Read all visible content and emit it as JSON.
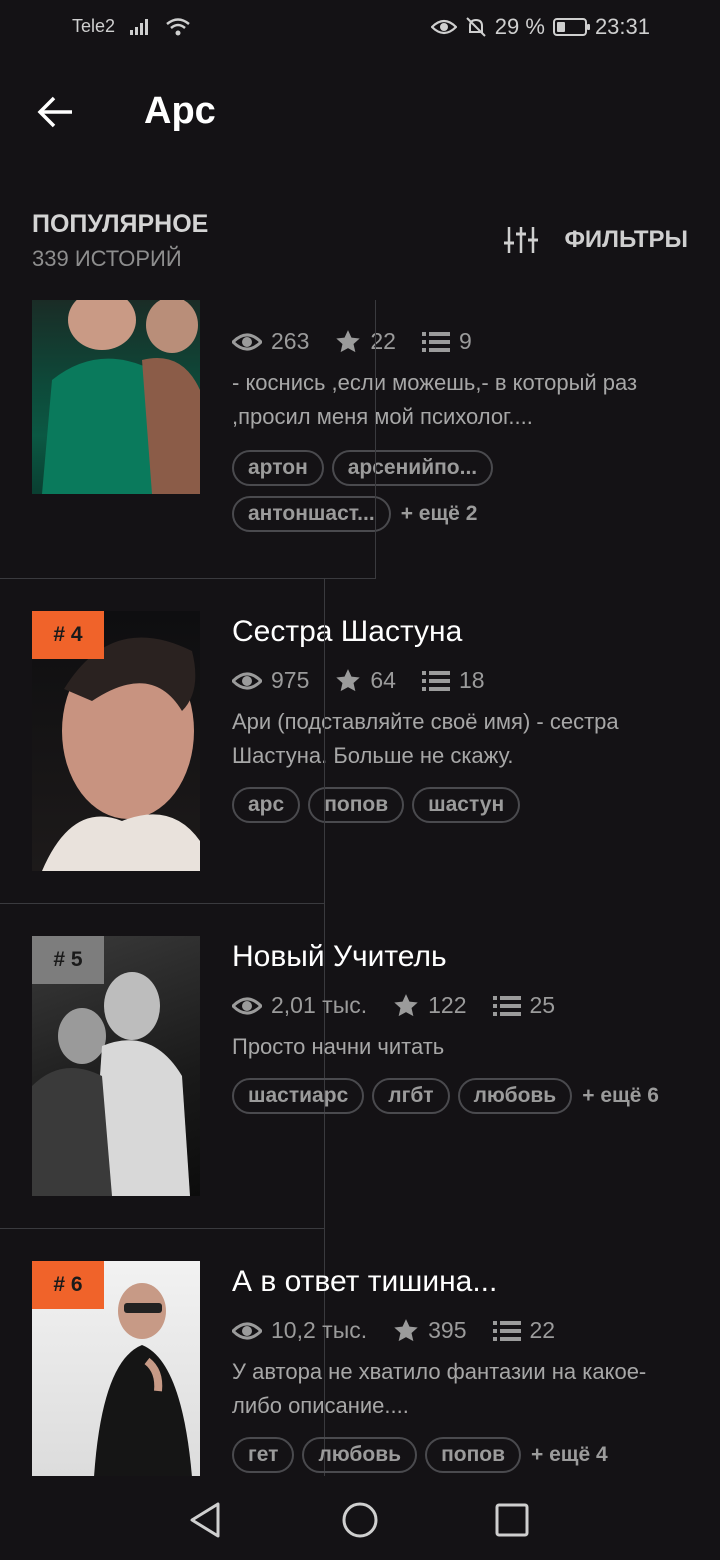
{
  "status": {
    "carrier": "Tele2",
    "battery": "29 %",
    "time": "23:31",
    "battery_level": 0.29
  },
  "header": {
    "title": "Арс"
  },
  "section": {
    "title": "ПОПУЛЯРНОЕ",
    "count": "339 ИСТОРИЙ",
    "filter_label": "ФИЛЬТРЫ"
  },
  "stories": [
    {
      "rank": "",
      "title": "",
      "views": "263",
      "stars": "22",
      "chapters": "9",
      "description": "- коснись ,если можешь,- в который раз ,просил меня мой психолог....",
      "tags": [
        "артон",
        "арсенийпо...",
        "антоншаст..."
      ],
      "more": "+ ещё 2"
    },
    {
      "rank": "# 4",
      "title": "Сестра Шастуна",
      "views": "975",
      "stars": "64",
      "chapters": "18",
      "description": "Ари (подставляйте своё имя) - сестра Шастуна. Больше не скажу.",
      "tags": [
        "арс",
        "попов",
        "шастун"
      ],
      "more": ""
    },
    {
      "rank": "# 5",
      "title": "Новый Учитель",
      "views": "2,01 тыс.",
      "stars": "122",
      "chapters": "25",
      "description": "Просто начни читать",
      "tags": [
        "шастиарс",
        "лгбт",
        "любовь"
      ],
      "more": "+ ещё 6"
    },
    {
      "rank": "# 6",
      "title": "А в ответ тишина...",
      "views": "10,2 тыс.",
      "stars": "395",
      "chapters": "22",
      "description": "У автора не хватило фантазии на какое-либо описание....",
      "tags": [
        "гет",
        "любовь",
        "попов"
      ],
      "more": "+ ещё 4"
    }
  ],
  "colors": {
    "background": "#141215",
    "accent": "#f0632a",
    "muted": "#9b9b9b"
  }
}
